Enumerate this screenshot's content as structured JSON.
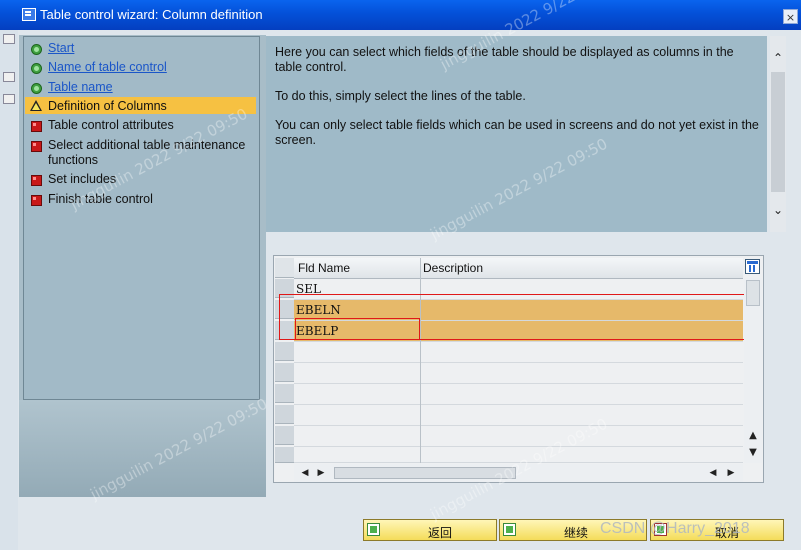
{
  "window": {
    "title": "Table control wizard: Column definition",
    "close_label": "×"
  },
  "steps": [
    {
      "label": "Start",
      "status": "done"
    },
    {
      "label": "Name of table control",
      "status": "done"
    },
    {
      "label": "Table name",
      "status": "done"
    },
    {
      "label": "Definition of Columns",
      "status": "current"
    },
    {
      "label": "Table control attributes",
      "status": "pending"
    },
    {
      "label": "Select additional table maintenance functions",
      "status": "pending"
    },
    {
      "label": "Set includes",
      "status": "pending"
    },
    {
      "label": "Finish table control",
      "status": "pending"
    }
  ],
  "info": {
    "p1": "Here you can select which fields of the table should be displayed as columns in the table control.",
    "p2": "To do this, simply select the lines of the table.",
    "p3": "You can only select table fields which can be used in screens and do not yet exist in the screen."
  },
  "table": {
    "columns": [
      "Fld Name",
      "Description"
    ],
    "rows": [
      {
        "field": "SEL",
        "description": "",
        "selected": false
      },
      {
        "field": "EBELN",
        "description": "",
        "selected": true
      },
      {
        "field": "EBELP",
        "description": "",
        "selected": true
      }
    ]
  },
  "buttons": {
    "back": "返回",
    "continue": "继续",
    "cancel": "取消"
  },
  "watermark": {
    "text": "jingguilin 2022 9/22 09:50",
    "csdn": "CSDN @Harry_2018"
  },
  "colors": {
    "titlebar": "#0450d8",
    "active_step": "#f6c142",
    "selected_row": "#e6b96a",
    "annotation": "#e01818"
  }
}
